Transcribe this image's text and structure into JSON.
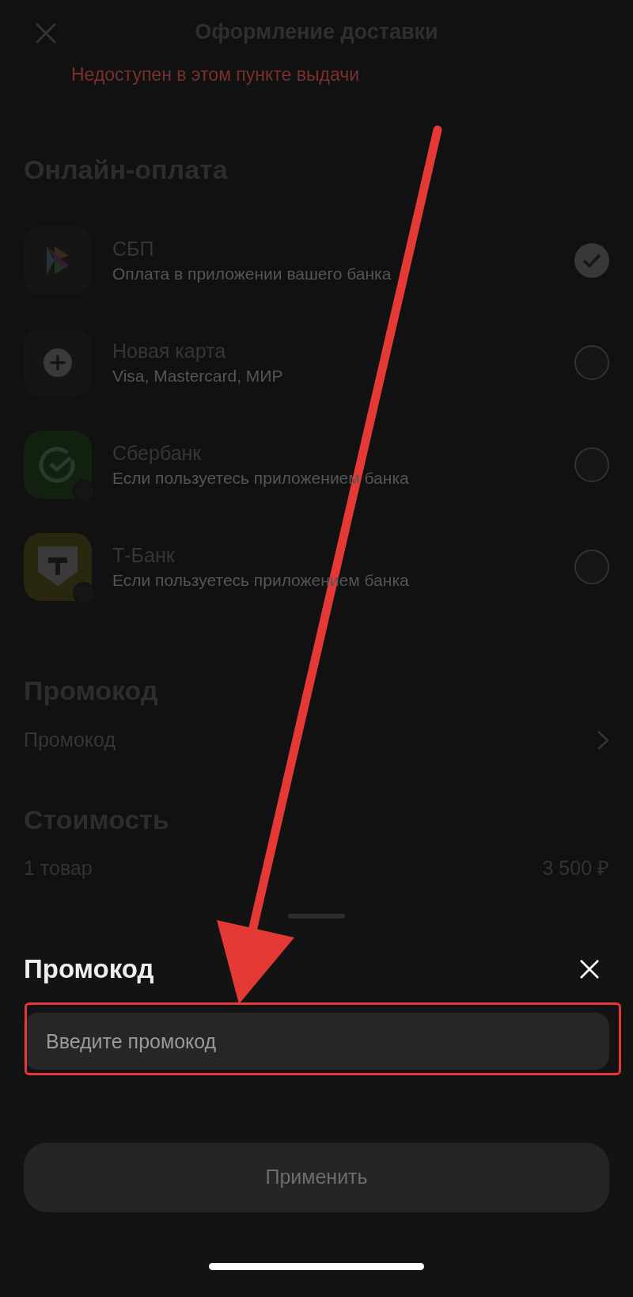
{
  "header": {
    "title": "Оформление доставки"
  },
  "notice": "Недоступен в этом пункте выдачи",
  "online_payment": {
    "title": "Онлайн-оплата",
    "methods": [
      {
        "kind": "sbp",
        "name": "СБП",
        "description": "Оплата в приложении вашего банка",
        "selected": true
      },
      {
        "kind": "card",
        "name": "Новая карта",
        "description": "Visa, Mastercard, МИР",
        "selected": false
      },
      {
        "kind": "sber",
        "name": "Сбербанк",
        "description": "Если пользуетесь приложением банка",
        "selected": false
      },
      {
        "kind": "tbank",
        "name": "Т-Банк",
        "description": "Если пользуетесь приложением банка",
        "selected": false
      }
    ]
  },
  "promo_section": {
    "title": "Промокод",
    "row_label": "Промокод"
  },
  "cost": {
    "title": "Стоимость",
    "rows": [
      {
        "label": "1 товар",
        "value": "3 500 ₽"
      }
    ]
  },
  "sheet": {
    "title": "Промокод",
    "placeholder": "Введите промокод",
    "apply_button": "Применить"
  }
}
